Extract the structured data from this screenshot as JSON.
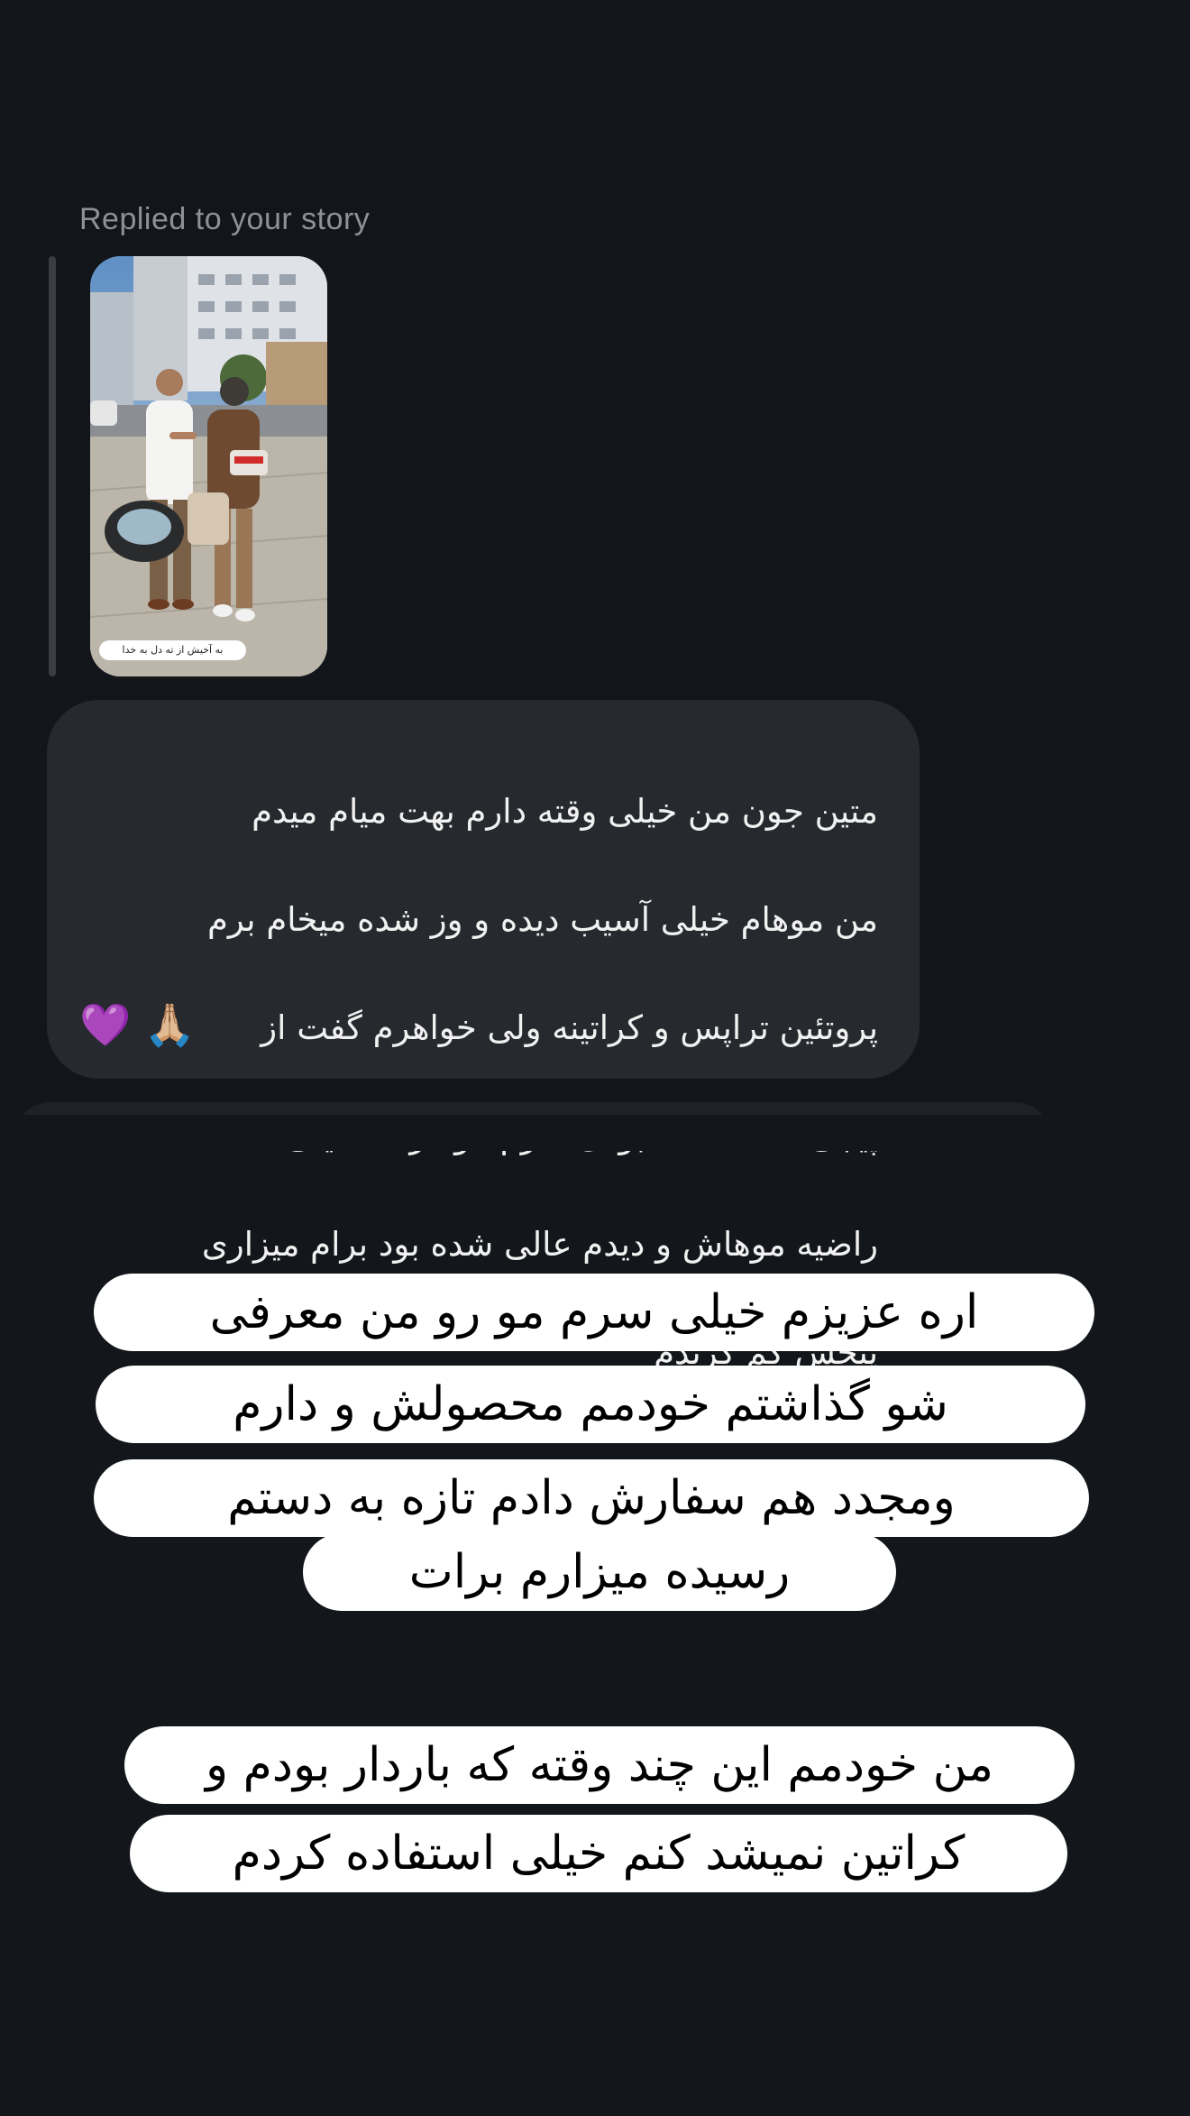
{
  "reply_label": "Replied to your story",
  "story": {
    "sticker_text": "به آخیش از ته دل به خدا"
  },
  "message": {
    "lines": [
      "متین جون من  خیلی وقته دارم بهت میام میدم",
      "من موهام خیلی آسیب دیده و وز شده میخام برم",
      "پروتئین تراپس و کراتینه  ولی خواهرم گفت از",
      "پیجی که گذاشته بودی سرم مو گرفته خیلی",
      "راضیه موهاش و دیدم عالی شده بود برام میزاری",
      "پیجش گم کریدم"
    ],
    "emoji": "💜 🙏🏼"
  },
  "overlay_1": {
    "lines": [
      "اره عزیزم خیلی سرم مو رو من معرفی",
      "شو گذاشتم خودمم محصولش و دارم",
      "ومجدد هم سفارش دادم تازه به دستم",
      "رسیده  میزارم برات"
    ]
  },
  "overlay_2": {
    "lines": [
      "من خودمم این چند وقته که باردار بودم و",
      "کراتین نمیشد کنم خیلی استفاده کردم"
    ]
  }
}
